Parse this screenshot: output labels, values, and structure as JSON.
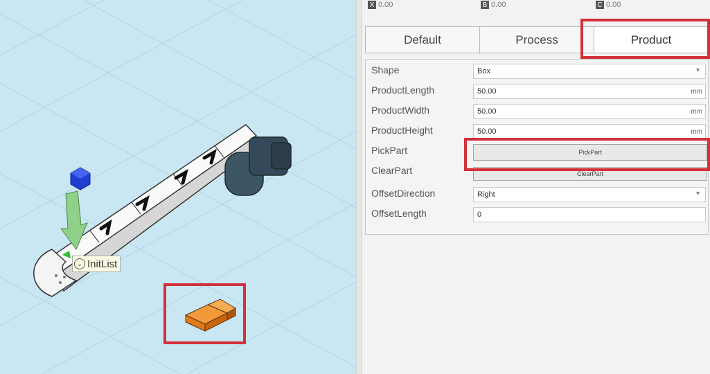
{
  "coords": [
    {
      "label": "X",
      "value": "0.00"
    },
    {
      "label": "B",
      "value": "0.00"
    },
    {
      "label": "C",
      "value": "0.00"
    }
  ],
  "tabs": [
    {
      "label": "Default"
    },
    {
      "label": "Process"
    },
    {
      "label": "Product"
    }
  ],
  "properties": {
    "shape": {
      "label": "Shape",
      "value": "Box"
    },
    "product_length": {
      "label": "ProductLength",
      "value": "50.00",
      "unit": "mm"
    },
    "product_width": {
      "label": "ProductWidth",
      "value": "50.00",
      "unit": "mm"
    },
    "product_height": {
      "label": "ProductHeight",
      "value": "50.00",
      "unit": "mm"
    },
    "pick_part": {
      "label": "PickPart",
      "button": "PickPart"
    },
    "clear_part": {
      "label": "ClearPart",
      "button": "ClearPart"
    },
    "offset_direction": {
      "label": "OffsetDirection",
      "value": "Right"
    },
    "offset_length": {
      "label": "OffsetLength",
      "value": "0"
    }
  },
  "viewport": {
    "tooltip": "InitList"
  },
  "colors": {
    "viewport_bg": "#c9e6f3",
    "highlight": "#d4303a",
    "product_box": "#e8821e",
    "frame_marker": "#1f3fd0",
    "arrow": "#8fd18a"
  }
}
